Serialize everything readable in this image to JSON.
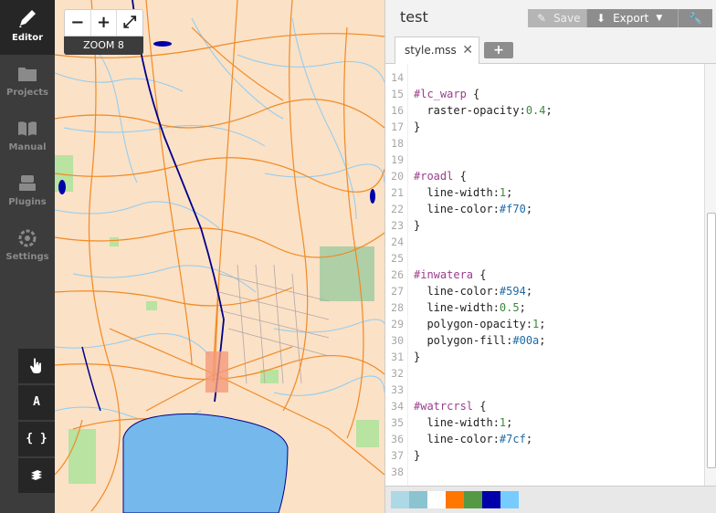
{
  "sidebar": {
    "items": [
      {
        "label": "Editor",
        "icon": "pencil-icon",
        "active": true
      },
      {
        "label": "Projects",
        "icon": "folder-icon",
        "active": false
      },
      {
        "label": "Manual",
        "icon": "book-icon",
        "active": false
      },
      {
        "label": "Plugins",
        "icon": "plugin-icon",
        "active": false
      },
      {
        "label": "Settings",
        "icon": "gear-icon",
        "active": false
      }
    ],
    "tools": [
      {
        "icon": "hand-pointer-icon",
        "text": ""
      },
      {
        "icon": "font-icon",
        "text": "A"
      },
      {
        "icon": "braces-icon",
        "text": "{ }"
      },
      {
        "icon": "layers-icon",
        "text": ""
      }
    ]
  },
  "map": {
    "zoom_out": "−",
    "zoom_in": "+",
    "fullscreen": "⤢",
    "zoom_label": "ZOOM 8"
  },
  "editor": {
    "project_title": "test",
    "save_label": "Save",
    "export_label": "Export",
    "active_tab": "style.mss",
    "tab_close": "✕",
    "add_tab": "+",
    "code_lines": [
      {
        "n": "14",
        "parts": []
      },
      {
        "n": "15",
        "parts": [
          {
            "t": "#lc_warp",
            "c": "sel"
          },
          {
            "t": " {",
            "c": "prop"
          }
        ]
      },
      {
        "n": "16",
        "parts": [
          {
            "t": "  raster-opacity:",
            "c": "prop"
          },
          {
            "t": "0.4",
            "c": "num"
          },
          {
            "t": ";",
            "c": "prop"
          }
        ]
      },
      {
        "n": "17",
        "parts": [
          {
            "t": "}",
            "c": "prop"
          }
        ]
      },
      {
        "n": "18",
        "parts": []
      },
      {
        "n": "19",
        "parts": []
      },
      {
        "n": "20",
        "parts": [
          {
            "t": "#roadl",
            "c": "sel"
          },
          {
            "t": " {",
            "c": "prop"
          }
        ]
      },
      {
        "n": "21",
        "parts": [
          {
            "t": "  line-width:",
            "c": "prop"
          },
          {
            "t": "1",
            "c": "num"
          },
          {
            "t": ";",
            "c": "prop"
          }
        ]
      },
      {
        "n": "22",
        "parts": [
          {
            "t": "  line-color:",
            "c": "prop"
          },
          {
            "t": "#f70",
            "c": "col"
          },
          {
            "t": ";",
            "c": "prop"
          }
        ]
      },
      {
        "n": "23",
        "parts": [
          {
            "t": "}",
            "c": "prop"
          }
        ]
      },
      {
        "n": "24",
        "parts": []
      },
      {
        "n": "25",
        "parts": []
      },
      {
        "n": "26",
        "parts": [
          {
            "t": "#inwatera",
            "c": "sel"
          },
          {
            "t": " {",
            "c": "prop"
          }
        ]
      },
      {
        "n": "27",
        "parts": [
          {
            "t": "  line-color:",
            "c": "prop"
          },
          {
            "t": "#594",
            "c": "col"
          },
          {
            "t": ";",
            "c": "prop"
          }
        ]
      },
      {
        "n": "28",
        "parts": [
          {
            "t": "  line-width:",
            "c": "prop"
          },
          {
            "t": "0.5",
            "c": "num"
          },
          {
            "t": ";",
            "c": "prop"
          }
        ]
      },
      {
        "n": "29",
        "parts": [
          {
            "t": "  polygon-opacity:",
            "c": "prop"
          },
          {
            "t": "1",
            "c": "num"
          },
          {
            "t": ";",
            "c": "prop"
          }
        ]
      },
      {
        "n": "30",
        "parts": [
          {
            "t": "  polygon-fill:",
            "c": "prop"
          },
          {
            "t": "#00a",
            "c": "col"
          },
          {
            "t": ";",
            "c": "prop"
          }
        ]
      },
      {
        "n": "31",
        "parts": [
          {
            "t": "}",
            "c": "prop"
          }
        ]
      },
      {
        "n": "32",
        "parts": []
      },
      {
        "n": "33",
        "parts": []
      },
      {
        "n": "34",
        "parts": [
          {
            "t": "#watrcrsl",
            "c": "sel"
          },
          {
            "t": " {",
            "c": "prop"
          }
        ]
      },
      {
        "n": "35",
        "parts": [
          {
            "t": "  line-width:",
            "c": "prop"
          },
          {
            "t": "1",
            "c": "num"
          },
          {
            "t": ";",
            "c": "prop"
          }
        ]
      },
      {
        "n": "36",
        "parts": [
          {
            "t": "  line-color:",
            "c": "prop"
          },
          {
            "t": "#7cf",
            "c": "col"
          },
          {
            "t": ";",
            "c": "prop"
          }
        ]
      },
      {
        "n": "37",
        "parts": [
          {
            "t": "}",
            "c": "prop"
          }
        ]
      },
      {
        "n": "38",
        "parts": []
      }
    ]
  },
  "palette": [
    "#add8e6",
    "#8bc3d0",
    "#ffffff",
    "#ff7700",
    "#559944",
    "#0000aa",
    "#77ccff"
  ],
  "colors": {
    "land": "#fbe1c6",
    "water": "#77bbee",
    "road": "#f08a24",
    "stream": "#77ccff",
    "vegetation": "#b6e29a",
    "lake": "#0000aa"
  }
}
